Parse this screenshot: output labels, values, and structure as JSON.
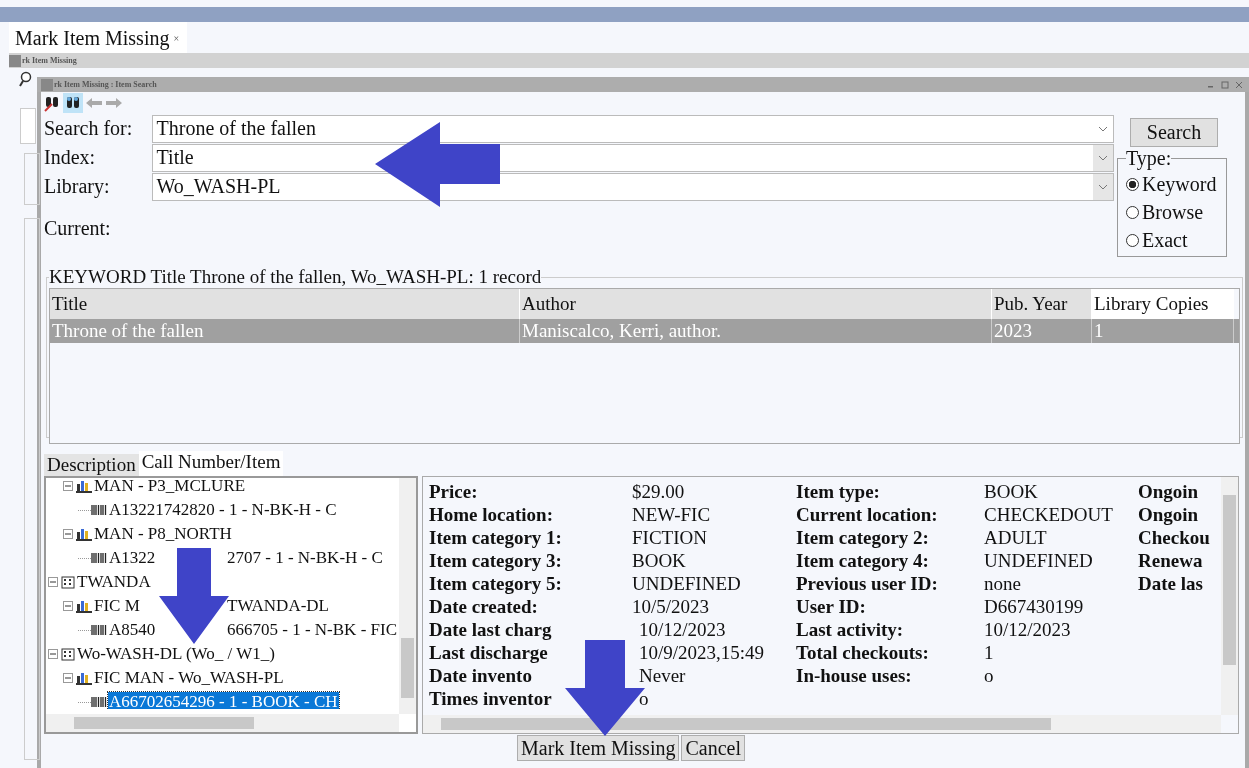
{
  "tab": {
    "label": "Mark Item Missing",
    "close": "×"
  },
  "outer_window": {
    "title": "rk Item Missing"
  },
  "dialog": {
    "title": "rk Item Missing : Item Search"
  },
  "form": {
    "fields": [
      {
        "label": "Search for:",
        "value": "Throne of the fallen"
      },
      {
        "label": "Index:",
        "value": "Title"
      },
      {
        "label": "Library:",
        "value": "Wo_WASH-PL"
      }
    ],
    "current_label": "Current:",
    "search_button": "Search",
    "type": {
      "legend": "Type:",
      "options": [
        {
          "label": "Keyword",
          "selected": true
        },
        {
          "label": "Browse",
          "selected": false
        },
        {
          "label": "Exact",
          "selected": false
        }
      ]
    }
  },
  "results": {
    "summary": "KEYWORD Title Throne of the fallen, Wo_WASH-PL: 1 record",
    "columns": [
      "Title",
      "Author",
      "Pub. Year",
      "Library Copies"
    ],
    "rows": [
      {
        "cells": [
          "Throne of the fallen",
          "Maniscalco, Kerri, author.",
          "2023",
          "1"
        ],
        "selected": true
      }
    ]
  },
  "detail_tabs": [
    {
      "label": "Description",
      "selected": false
    },
    {
      "label": "Call Number/Item",
      "selected": true
    }
  ],
  "tree": {
    "scrolled_children": [
      {
        "kind": "call",
        "parts": [
          "MAN - P3_MCLURE"
        ],
        "expanded": true,
        "children": [
          {
            "kind": "item",
            "parts": [
              "A13221742820 - 1 - N-BK-H - C"
            ],
            "selected": false
          }
        ]
      },
      {
        "kind": "call",
        "parts": [
          "MAN - P8_NORTH"
        ],
        "expanded": true,
        "children": [
          {
            "kind": "item",
            "parts": [
              "A1322",
              "2707 - 1 - N-BK-H - C"
            ],
            "selected": false
          }
        ]
      }
    ],
    "nodes": [
      {
        "kind": "library",
        "parts": [
          "TWANDA"
        ],
        "expanded": true,
        "children": [
          {
            "kind": "call",
            "parts": [
              "FIC M",
              "TWANDA-DL"
            ],
            "expanded": true,
            "children": [
              {
                "kind": "item",
                "parts": [
                  "A8540",
                  "666705 - 1 - N-BK - FIC"
                ],
                "selected": false
              }
            ]
          }
        ]
      },
      {
        "kind": "library",
        "parts": [
          "Wo-WASH-DL (Wo_ / W1_)"
        ],
        "expanded": true,
        "children": [
          {
            "kind": "call",
            "parts": [
              "FIC MAN - Wo_WASH-PL"
            ],
            "expanded": true,
            "children": [
              {
                "kind": "item",
                "parts": [
                  "A66702654296 - 1 - BOOK - CH"
                ],
                "selected": true
              }
            ]
          }
        ]
      }
    ]
  },
  "details": [
    [
      {
        "label": "Price:",
        "value": "$29.00"
      },
      {
        "label": "Home location:",
        "value": "NEW-FIC"
      },
      {
        "label": "Item category 1:",
        "value": "FICTION"
      },
      {
        "label": "Item category 3:",
        "value": "BOOK"
      },
      {
        "label": "Item category 5:",
        "value": "UNDEFINED"
      },
      {
        "label": "Date created:",
        "value": "10/5/2023"
      },
      {
        "label": "Date last charg",
        "value": "10/12/2023"
      },
      {
        "label": "Last discharge",
        "value": "10/9/2023,15:49"
      },
      {
        "label": "Date invento",
        "value": "Never"
      },
      {
        "label": "Times inventor",
        "value": "o"
      }
    ],
    [
      {
        "label": "Item type:",
        "value": "BOOK"
      },
      {
        "label": "Current location:",
        "value": "CHECKEDOUT"
      },
      {
        "label": "Item category 2:",
        "value": "ADULT"
      },
      {
        "label": "Item category 4:",
        "value": "UNDEFINED"
      },
      {
        "label": "Previous user ID:",
        "value": "none"
      },
      {
        "label": "User ID:",
        "value": "D667430199"
      },
      {
        "label": "Last activity:",
        "value": "10/12/2023"
      },
      {
        "label": "Total checkouts:",
        "value": "1"
      },
      {
        "label": "In-house uses:",
        "value": "o"
      }
    ],
    [
      {
        "label": "Ongoin"
      },
      {
        "label": "Ongoin"
      },
      {
        "label": "Checkou"
      },
      {
        "label": "Renewa"
      },
      {
        "label": "Date las"
      }
    ]
  ],
  "buttons": [
    "Mark Item Missing",
    "Cancel"
  ],
  "arrows": [
    {
      "kind": "left"
    },
    {
      "kind": "down"
    },
    {
      "kind": "down"
    }
  ]
}
